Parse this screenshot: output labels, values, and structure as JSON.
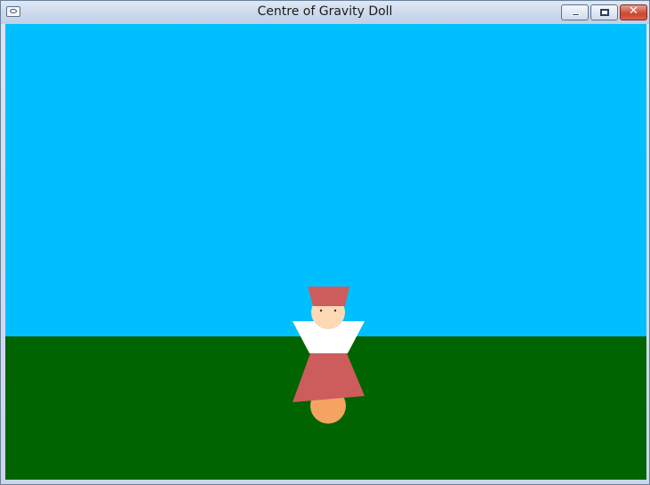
{
  "window": {
    "title": "Centre of Gravity Doll",
    "controls": [
      "minimize",
      "maximize",
      "close"
    ],
    "close_glyph": "✕"
  },
  "scene": {
    "sky_color": "#00bfff",
    "ground_color": "#006400",
    "doll": {
      "hat_color": "#cd5c5c",
      "face_color": "#fdd9b5",
      "collar_color": "#ffffff",
      "skirt_color": "#cd5c5c",
      "base_color": "#f4a460",
      "eye_color": "#3a2a2a"
    }
  }
}
